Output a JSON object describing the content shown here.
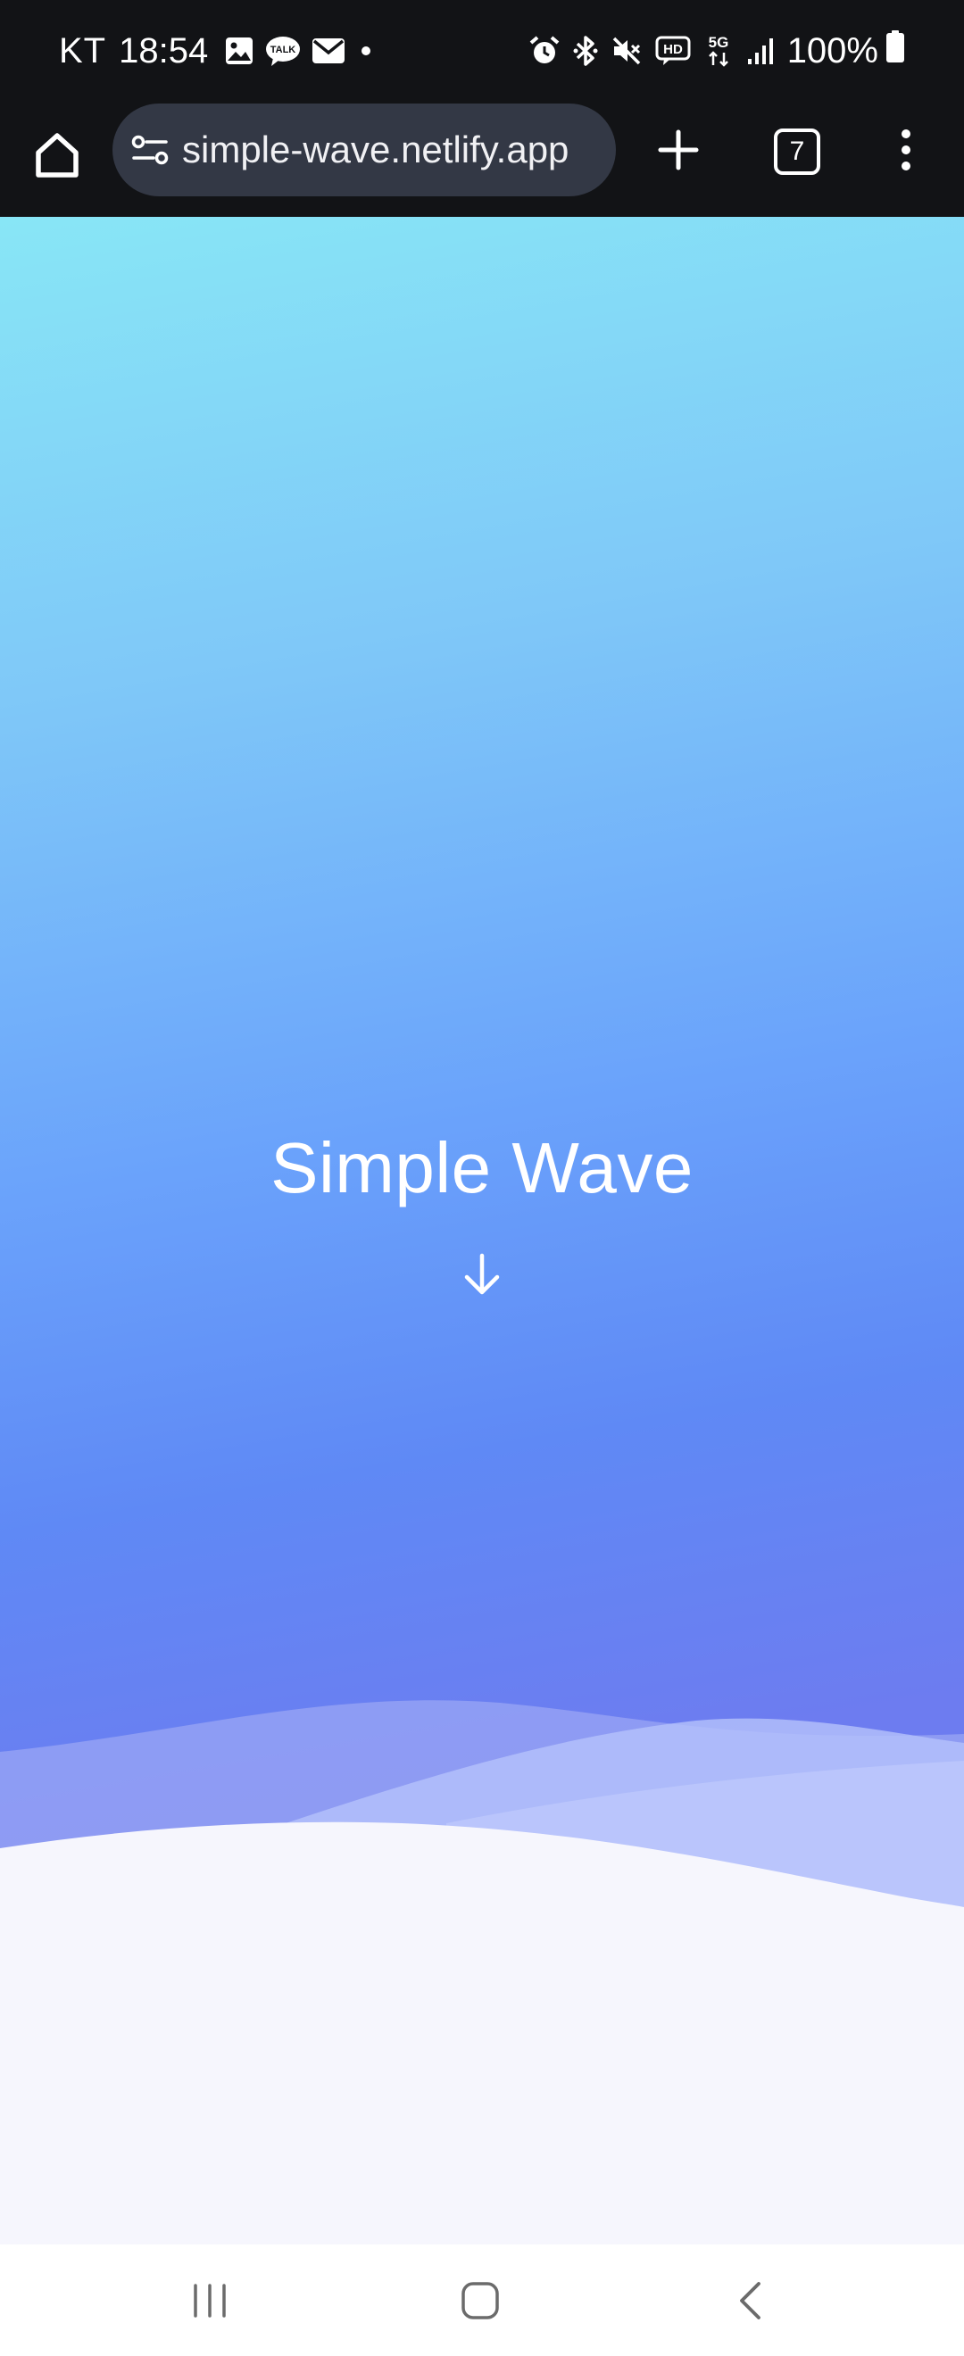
{
  "status_bar": {
    "carrier": "KT",
    "time": "18:54",
    "left_icons": [
      "gallery-icon",
      "kakaotalk-icon",
      "mail-icon",
      "dot-icon"
    ],
    "kakao_label": "TALK",
    "right_icons": [
      "alarm-icon",
      "bluetooth-icon",
      "mute-icon",
      "hd-voice-icon",
      "5g-icon",
      "signal-icon",
      "battery-icon"
    ],
    "hd_label": "HD",
    "network_label": "5G",
    "battery_percent": "100%"
  },
  "browser": {
    "url": "simple-wave.netlify.app",
    "tab_count": "7",
    "icons": {
      "home": "home-icon",
      "site_info": "site-settings-icon",
      "new_tab": "plus-icon",
      "menu": "more-vertical-icon"
    }
  },
  "page": {
    "title": "Simple Wave",
    "scroll_icon": "arrow-down-icon"
  },
  "nav_bar": {
    "icons": [
      "recents-icon",
      "home-icon",
      "back-icon"
    ]
  },
  "colors": {
    "status_bg": "#121316",
    "url_bar_bg": "#333845",
    "gradient_top": "#88e6f6",
    "gradient_mid": "#6aa2fb",
    "gradient_bottom": "#6d7cf0",
    "wave_light": "#f6f6fd",
    "text_white": "#ffffff"
  }
}
